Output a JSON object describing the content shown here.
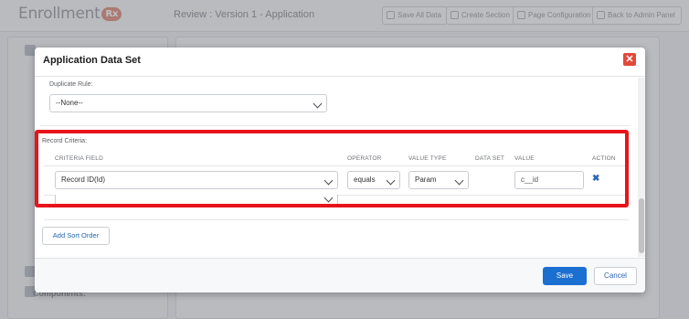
{
  "app": {
    "logo_text": "Enrollment",
    "logo_badge": "Rx",
    "page_title": "Review : Version 1 - Application",
    "header_buttons": [
      "Save All Data",
      "Create Section",
      "Page Configuration",
      "Back to Admin Panel"
    ],
    "left_panel": {
      "components_label": "Components:"
    }
  },
  "modal": {
    "title": "Application Data Set",
    "close_icon": "close-icon",
    "duplicate_rule": {
      "label": "Duplicate Rule:",
      "value": "--None--"
    },
    "record_criteria": {
      "label": "Record Criteria:",
      "columns": [
        "CRITERIA FIELD",
        "OPERATOR",
        "VALUE TYPE",
        "DATA SET",
        "VALUE",
        "ACTION"
      ],
      "rows": [
        {
          "field": "Record ID(Id)",
          "operator": "equals",
          "value_type": "Param",
          "data_set": "",
          "value": "c__id",
          "action_icon": "delete-icon"
        }
      ],
      "empty_field_value": ""
    },
    "add_sort_order_label": "Add Sort Order",
    "save_label": "Save",
    "cancel_label": "Cancel"
  },
  "colors": {
    "highlight": "#e8141b",
    "primary": "#1b6fd1",
    "close": "#e04a3a"
  }
}
